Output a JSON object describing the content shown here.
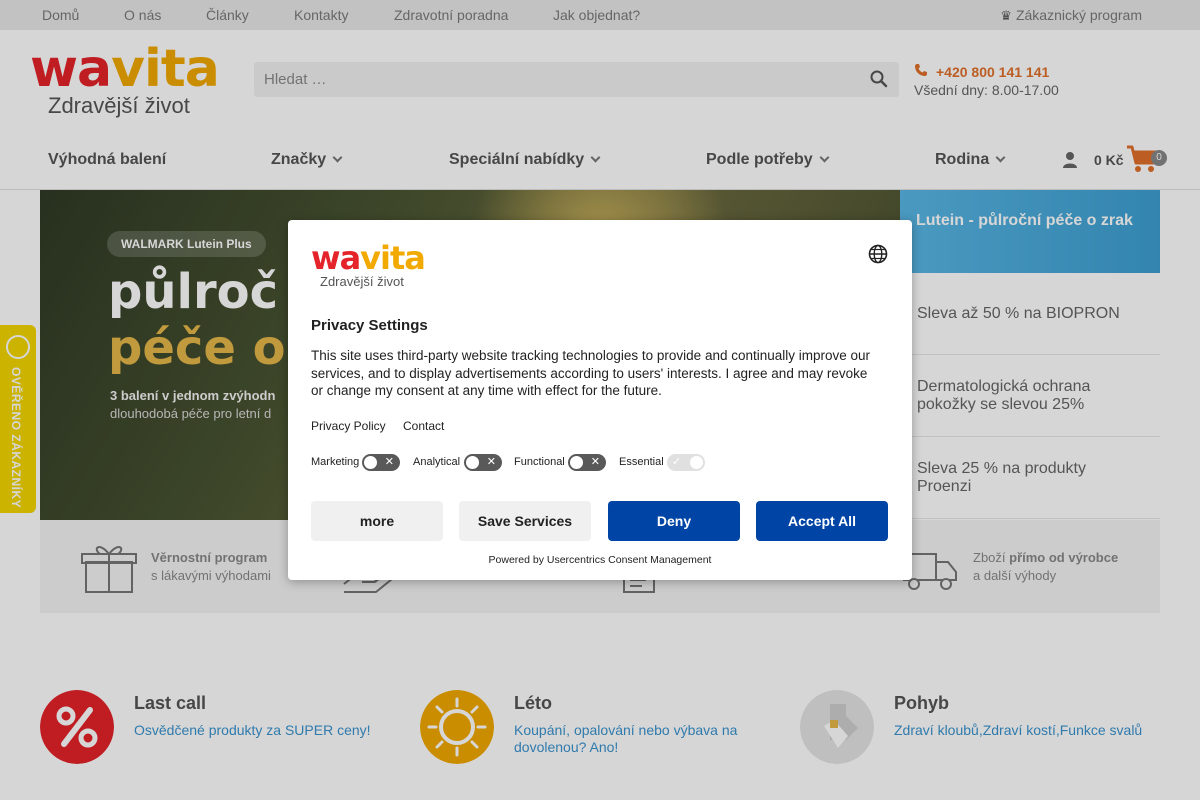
{
  "topbar": {
    "links": [
      "Domů",
      "O nás",
      "Články",
      "Kontakty",
      "Zdravotní poradna",
      "Jak objednat?"
    ],
    "program": "Zákaznický program"
  },
  "header": {
    "logo_part1": "wa",
    "logo_part2": "vita",
    "tagline": "Zdravější život",
    "search_placeholder": "Hledat …",
    "phone": "+420 800 141 141",
    "hours": "Všední dny: 8.00-17.00"
  },
  "nav": {
    "items": [
      {
        "label": "Výhodná balení",
        "has_dropdown": false
      },
      {
        "label": "Značky",
        "has_dropdown": true
      },
      {
        "label": "Speciální nabídky",
        "has_dropdown": true
      },
      {
        "label": "Podle potřeby",
        "has_dropdown": true
      },
      {
        "label": "Rodina",
        "has_dropdown": true
      }
    ],
    "cart_total": "0 Kč",
    "cart_count": "0"
  },
  "hero": {
    "pill": "WALMARK Lutein Plus",
    "headline1": "půlroč",
    "headline2": "péče o",
    "line1": "3 balení v jednom zvýhodn",
    "line2": "dlouhodobá péče pro letní d"
  },
  "side_promos": {
    "active": "Lutein - půlroční péče o zrak",
    "items": [
      "Sleva až 50 % na BIOPRON",
      "Dermatologická ochrana pokožky se slevou 25%",
      "Sleva 25 % na produkty Proenzi"
    ]
  },
  "benefits": [
    {
      "bold": "Věrnostní program",
      "text": "s lákavými výhodami"
    },
    {
      "bold": "",
      "text": ""
    },
    {
      "bold": "",
      "text": ""
    },
    {
      "pre": "Zboží ",
      "bold": "přímo od výrobce",
      "text": "a další výhody"
    }
  ],
  "categories": [
    {
      "title": "Last call",
      "links": "Osvědčené produkty za SUPER ceny!",
      "color": "#e5232a"
    },
    {
      "title": "Léto",
      "links": "Koupání, opalování nebo výbava na dovolenou? Ano!",
      "color": "#f2a900"
    },
    {
      "title": "Pohyb",
      "links": "Zdraví kloubů,Zdraví kostí,Funkce svalů",
      "color": "#d8d8d8"
    }
  ],
  "verified_badge": "OVĚŘENO ZÁKAZNÍKY",
  "consent": {
    "logo_part1": "wa",
    "logo_part2": "vita",
    "tagline": "Zdravější život",
    "title": "Privacy Settings",
    "description": "This site uses third-party website tracking technologies to provide and continually improve our services, and to display advertisements according to users' interests. I agree and may revoke or change my consent at any time with effect for the future.",
    "privacy_policy": "Privacy Policy",
    "contact": "Contact",
    "toggles": [
      {
        "label": "Marketing",
        "on": false
      },
      {
        "label": "Analytical",
        "on": false
      },
      {
        "label": "Functional",
        "on": false
      },
      {
        "label": "Essential",
        "on": true
      }
    ],
    "buttons": {
      "more": "more",
      "save": "Save Services",
      "deny": "Deny",
      "accept": "Accept All"
    },
    "powered_by": "Powered by Usercentrics Consent Management"
  },
  "colors": {
    "brand_red": "#e5232a",
    "brand_yellow": "#f2a900",
    "accent_blue": "#0045a5",
    "phone_orange": "#e0712b",
    "link_blue": "#3a93cf"
  }
}
